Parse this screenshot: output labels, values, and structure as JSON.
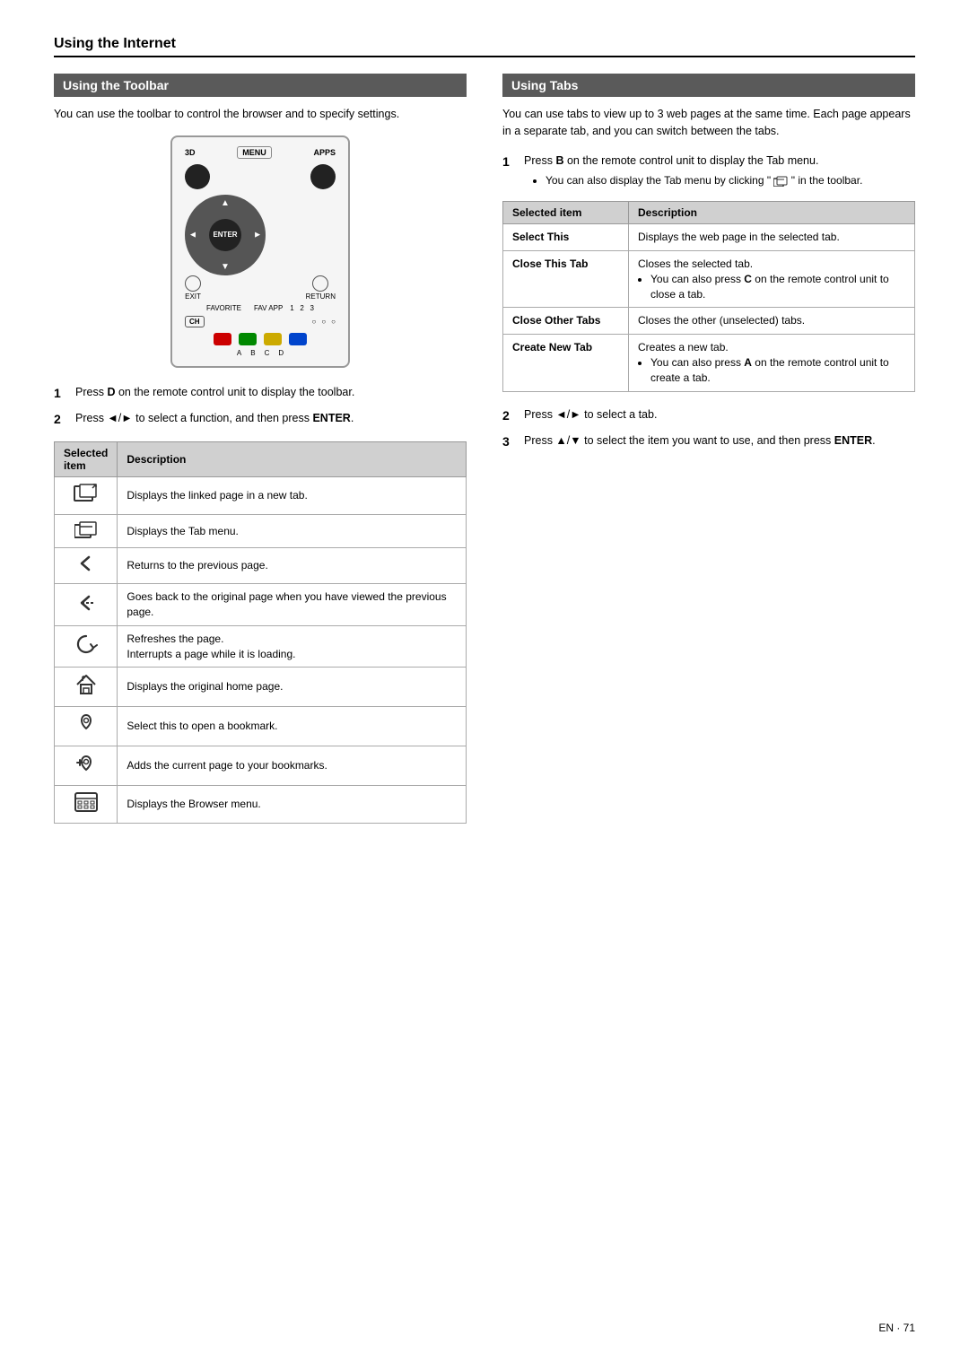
{
  "page": {
    "title": "Using the Internet",
    "page_number": "EN · 71"
  },
  "left_section": {
    "header": "Using the Toolbar",
    "description": "You can use the toolbar to control the browser and to specify settings.",
    "step1": {
      "number": "1",
      "text": "Press ",
      "bold": "D",
      "text2": " on the remote control unit to display the toolbar."
    },
    "step2": {
      "number": "2",
      "text": "Press ",
      "icon": "◄/►",
      "text2": " to select a function, and then press ",
      "bold": "ENTER",
      "text3": "."
    },
    "table": {
      "col1": "Selected item",
      "col2": "Description",
      "rows": [
        {
          "icon": "⬚↗",
          "desc": "Displays the linked page in a new tab."
        },
        {
          "icon": "⬚",
          "desc": "Displays the Tab menu."
        },
        {
          "icon": "◁",
          "desc": "Returns to the previous page."
        },
        {
          "icon": "↩",
          "desc": "Goes back to the original page when you have viewed the previous page."
        },
        {
          "icon": "↺",
          "desc": "Refreshes the page.\nInterrupts a page while it is loading."
        },
        {
          "icon": "⌂",
          "desc": "Displays the original home page."
        },
        {
          "icon": "♡",
          "desc": "Select this to open a bookmark."
        },
        {
          "icon": "⊕♡",
          "desc": "Adds the current page to your bookmarks."
        },
        {
          "icon": "⊞",
          "desc": "Displays the Browser menu."
        }
      ]
    }
  },
  "right_section": {
    "header": "Using Tabs",
    "description": "You can use tabs to view up to 3 web pages at the same time. Each page appears in a separate tab, and you can switch between the tabs.",
    "step1": {
      "number": "1",
      "text": "Press ",
      "bold": "B",
      "text2": " on the remote control unit to display the Tab menu.",
      "sub": "You can also display the Tab menu by clicking \"",
      "sub_icon": "⬚",
      "sub2": "\" in the toolbar."
    },
    "table": {
      "col1": "Selected item",
      "col2": "Description",
      "rows": [
        {
          "item": "Select This",
          "desc": "Displays the web page in the selected tab.",
          "sub": null
        },
        {
          "item": "Close This Tab",
          "desc": "Closes the selected tab.",
          "sub": "You can also press C on the remote control unit to close a tab."
        },
        {
          "item": "Close Other Tabs",
          "desc": "Closes the other (unselected) tabs.",
          "sub": null
        },
        {
          "item": "Create New Tab",
          "desc": "Creates a new tab.",
          "sub": "You can also press A on the remote control unit to create a tab."
        }
      ]
    },
    "step2": {
      "number": "2",
      "text": "Press ",
      "icon": "◄/►",
      "text2": " to select a tab."
    },
    "step3": {
      "number": "3",
      "text": "Press ",
      "icon": "▲/▼",
      "text2": " to select the item you want to use, and then press ",
      "bold": "ENTER",
      "text3": "."
    }
  },
  "remote": {
    "label_3d": "3D",
    "label_menu": "MENU",
    "label_apps": "APPS",
    "label_enter": "ENTER",
    "label_exit": "EXIT",
    "label_return": "RETURN",
    "label_fav": "FAVORITE",
    "label_fav_app": "FAV APP",
    "label_ch": "CH",
    "color_labels": [
      "A",
      "B",
      "C",
      "D"
    ]
  }
}
